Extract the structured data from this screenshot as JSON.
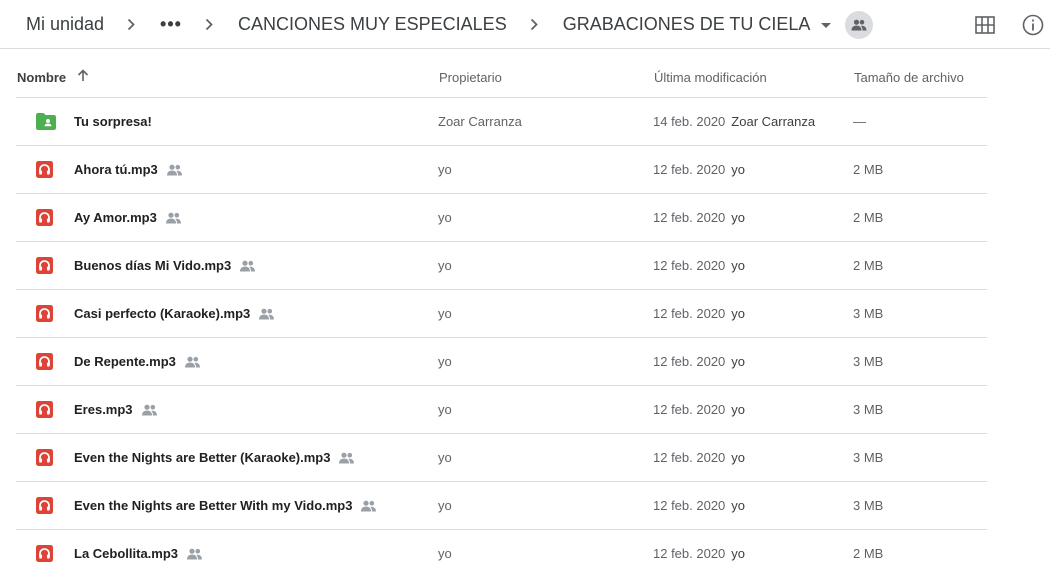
{
  "breadcrumb": {
    "root": "Mi unidad",
    "more": "•••",
    "parent": "CANCIONES MUY ESPECIALES",
    "current": "GRABACIONES DE TU CIELA"
  },
  "toolbar": {
    "grid_icon": "grid-view-icon",
    "info_icon": "info-icon"
  },
  "columns": {
    "name": "Nombre",
    "owner": "Propietario",
    "modified": "Última modificación",
    "size": "Tamaño de archivo"
  },
  "colors": {
    "folder": "#4caf50",
    "audio": "#db4437",
    "divider": "#dadce0"
  },
  "rows": [
    {
      "name": "Tu sorpresa!",
      "type": "shared-folder",
      "shared": false,
      "owner": "Zoar Carranza",
      "date": "14 feb. 2020",
      "by": "Zoar Carranza",
      "size": "—"
    },
    {
      "name": "Ahora tú.mp3",
      "type": "audio",
      "shared": true,
      "owner": "yo",
      "date": "12 feb. 2020",
      "by": "yo",
      "size": "2 MB"
    },
    {
      "name": "Ay Amor.mp3",
      "type": "audio",
      "shared": true,
      "owner": "yo",
      "date": "12 feb. 2020",
      "by": "yo",
      "size": "2 MB"
    },
    {
      "name": "Buenos días Mi Vido.mp3",
      "type": "audio",
      "shared": true,
      "owner": "yo",
      "date": "12 feb. 2020",
      "by": "yo",
      "size": "2 MB"
    },
    {
      "name": "Casi perfecto (Karaoke).mp3",
      "type": "audio",
      "shared": true,
      "owner": "yo",
      "date": "12 feb. 2020",
      "by": "yo",
      "size": "3 MB"
    },
    {
      "name": "De Repente.mp3",
      "type": "audio",
      "shared": true,
      "owner": "yo",
      "date": "12 feb. 2020",
      "by": "yo",
      "size": "3 MB"
    },
    {
      "name": "Eres.mp3",
      "type": "audio",
      "shared": true,
      "owner": "yo",
      "date": "12 feb. 2020",
      "by": "yo",
      "size": "3 MB"
    },
    {
      "name": "Even the Nights are Better (Karaoke).mp3",
      "type": "audio",
      "shared": true,
      "owner": "yo",
      "date": "12 feb. 2020",
      "by": "yo",
      "size": "3 MB"
    },
    {
      "name": "Even the Nights are Better With my Vido.mp3",
      "type": "audio",
      "shared": true,
      "owner": "yo",
      "date": "12 feb. 2020",
      "by": "yo",
      "size": "3 MB"
    },
    {
      "name": "La Cebollita.mp3",
      "type": "audio",
      "shared": true,
      "owner": "yo",
      "date": "12 feb. 2020",
      "by": "yo",
      "size": "2 MB"
    }
  ]
}
